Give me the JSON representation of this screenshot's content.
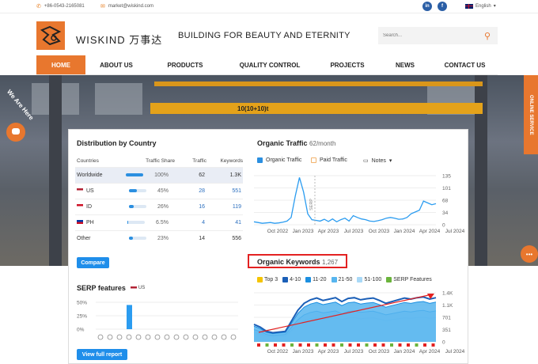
{
  "topbar": {
    "phone": "+86-0543-2165081",
    "email": "market@wiskind.com",
    "language": "English"
  },
  "header": {
    "brand": "WISKIND 万事达",
    "slogan": "BUILDING FOR BEAUTY AND ETERNITY",
    "search_placeholder": "Search..."
  },
  "nav": {
    "items": [
      "HOME",
      "ABOUT US",
      "PRODUCTS",
      "QUALITY CONTROL",
      "PROJECTS",
      "NEWS",
      "CONTACT US"
    ],
    "active": "HOME"
  },
  "hero": {
    "online_service": "ONLINE SERVICE",
    "we_are_here": "We Are Here",
    "beam_label": "10(10+10)t"
  },
  "distribution": {
    "title": "Distribution by Country",
    "headers": [
      "Countries",
      "Traffic Share",
      "Traffic",
      "Keywords"
    ],
    "rows": [
      {
        "country": "Worldwide",
        "share": "100%",
        "share_value": 100,
        "traffic": "62",
        "keywords": "1.3K"
      },
      {
        "country": "US",
        "share": "45%",
        "share_value": 45,
        "traffic": "28",
        "keywords": "551"
      },
      {
        "country": "ID",
        "share": "26%",
        "share_value": 26,
        "traffic": "16",
        "keywords": "119"
      },
      {
        "country": "PH",
        "share": "6.5%",
        "share_value": 6.5,
        "traffic": "4",
        "keywords": "41"
      },
      {
        "country": "Other",
        "share": "23%",
        "share_value": 23,
        "traffic": "14",
        "keywords": "556"
      }
    ],
    "compare_label": "Compare"
  },
  "serp": {
    "title": "SERP features",
    "country": "US",
    "yticks": [
      "50%",
      "25%",
      "0%"
    ],
    "view_full_report": "View full report"
  },
  "organic_traffic": {
    "title": "Organic Traffic",
    "value": "62/month",
    "legend": [
      "Organic Traffic",
      "Paid Traffic"
    ],
    "notes": "Notes",
    "yticks": [
      "135",
      "101",
      "68",
      "34",
      "0"
    ],
    "xticks": [
      "Oct 2022",
      "Jan 2023",
      "Apr 2023",
      "Jul 2023",
      "Oct 2023",
      "Jan 2024",
      "Apr 2024",
      "Jul 2024"
    ],
    "serp_label": "SERP"
  },
  "organic_keywords": {
    "title": "Organic Keywords",
    "value": "1,267",
    "legend": [
      "Top 3",
      "4-10",
      "11-20",
      "21-50",
      "51-100",
      "SERP Features"
    ],
    "legend_colors": [
      "#f5c400",
      "#1b5fb7",
      "#1c8fe0",
      "#57b5ef",
      "#a9d9f7",
      "#6bb43c"
    ],
    "yticks": [
      "1.4K",
      "1.1K",
      "701",
      "351",
      "0"
    ],
    "xticks": [
      "Oct 2022",
      "Jan 2023",
      "Apr 2023",
      "Jul 2023",
      "Oct 2023",
      "Jan 2024",
      "Apr 2024",
      "Jul 2024"
    ]
  },
  "chart_data": [
    {
      "type": "line",
      "title": "Organic Traffic",
      "x": [
        "Oct 2022",
        "Jan 2023",
        "Apr 2023",
        "Jul 2023",
        "Oct 2023",
        "Jan 2024",
        "Apr 2024",
        "Jul 2024"
      ],
      "series": [
        {
          "name": "Organic Traffic",
          "values": [
            8,
            10,
            130,
            12,
            25,
            20,
            18,
            60
          ]
        }
      ],
      "ylim": [
        0,
        135
      ]
    },
    {
      "type": "bar",
      "title": "SERP features",
      "series": [
        {
          "values": [
            0,
            0,
            0,
            45,
            0,
            0,
            0,
            0,
            0,
            0,
            0,
            0,
            0,
            0,
            0
          ]
        }
      ],
      "ylim": [
        0,
        50
      ]
    },
    {
      "type": "area",
      "title": "Organic Keywords",
      "x": [
        "Oct 2022",
        "Jan 2023",
        "Apr 2023",
        "Jul 2023",
        "Oct 2023",
        "Jan 2024",
        "Apr 2024",
        "Jul 2024"
      ],
      "series": [
        {
          "name": "4-10",
          "values": [
            500,
            300,
            1200,
            1300,
            1150,
            1250,
            1100,
            1260
          ]
        },
        {
          "name": "11-20",
          "values": [
            450,
            280,
            1100,
            1200,
            1050,
            1150,
            1000,
            1150
          ]
        },
        {
          "name": "21-50",
          "values": [
            420,
            260,
            900,
            950,
            850,
            900,
            820,
            900
          ]
        },
        {
          "name": "51-100",
          "values": [
            400,
            250,
            800,
            800,
            720,
            750,
            700,
            750
          ]
        }
      ],
      "ylim": [
        0,
        1400
      ]
    }
  ]
}
